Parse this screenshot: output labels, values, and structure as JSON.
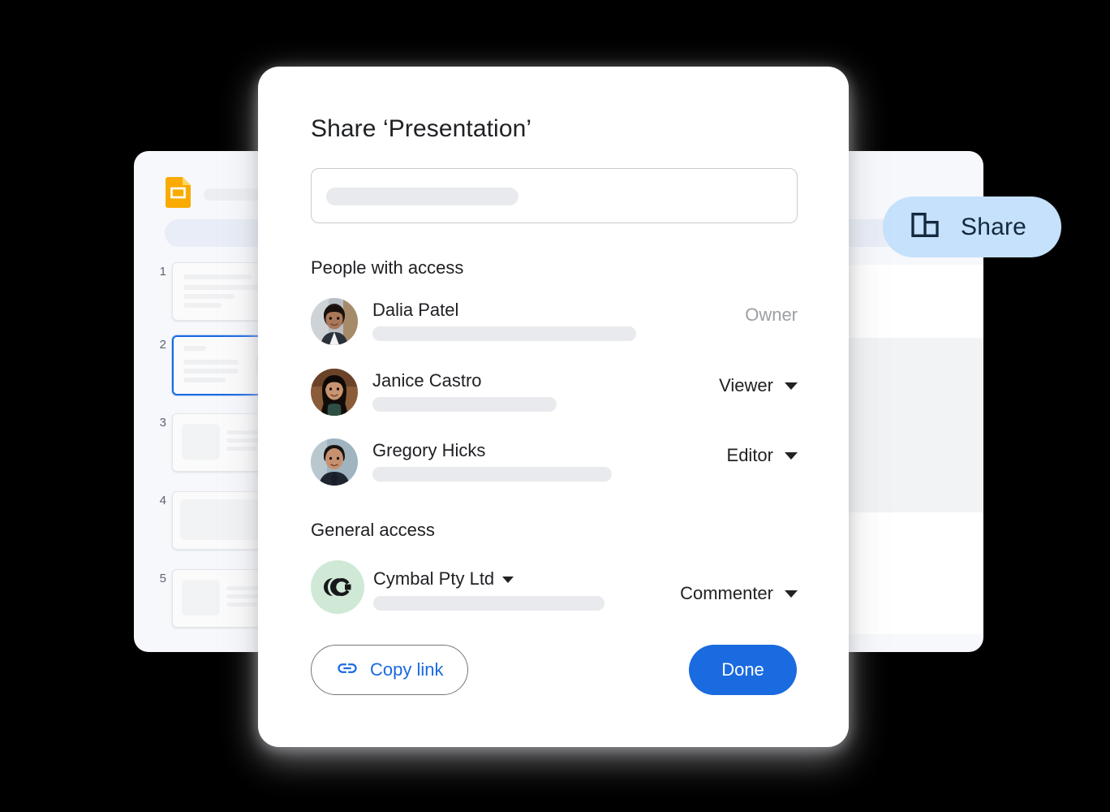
{
  "document_panel": {
    "app_icon": "google-slides-icon",
    "slides": [
      {
        "number": "1",
        "layout": "text-lines"
      },
      {
        "number": "2",
        "layout": "title-text-circle",
        "selected": true
      },
      {
        "number": "3",
        "layout": "image-left-text-right"
      },
      {
        "number": "4",
        "layout": "full-block"
      },
      {
        "number": "5",
        "layout": "image-left-text-right"
      }
    ]
  },
  "share_pill": {
    "label": "Share",
    "icon": "domain-building-icon",
    "background_color": "#c5e1fb",
    "text_color": "#14293e"
  },
  "dialog": {
    "title": "Share ‘Presentation’",
    "input": {
      "value": "",
      "placeholder": ""
    },
    "people_section": {
      "heading": "People with access",
      "people": [
        {
          "name": "Dalia Patel",
          "role": "Owner",
          "has_dropdown": false,
          "avatar": "photo-avatar-dalia"
        },
        {
          "name": "Janice Castro",
          "role": "Viewer",
          "has_dropdown": true,
          "avatar": "photo-avatar-janice"
        },
        {
          "name": "Gregory Hicks",
          "role": "Editor",
          "has_dropdown": true,
          "avatar": "photo-avatar-gregory"
        }
      ]
    },
    "general_section": {
      "heading": "General access",
      "org_name": "Cymbal Pty Ltd",
      "org_logo": "cymbal-logo",
      "org_role": "Commenter"
    },
    "footer": {
      "copy_link_label": "Copy link",
      "copy_link_icon": "link-chain-icon",
      "done_label": "Done"
    }
  },
  "colors": {
    "primary_blue": "#1a6ae0",
    "share_pill_blue": "#c5e1fb",
    "slides_yellow": "#f9ab00",
    "org_green": "#cfe9d6",
    "panel_background": "#f6f8fc"
  }
}
